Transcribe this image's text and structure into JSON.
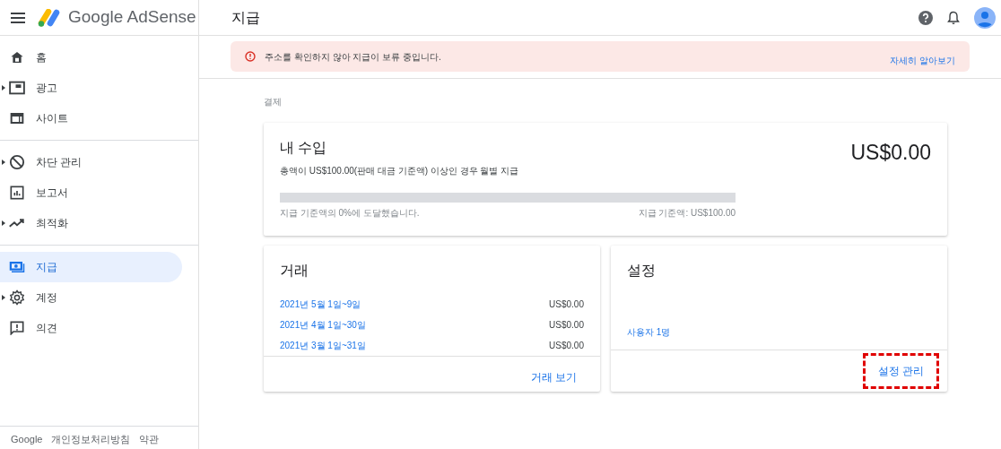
{
  "header": {
    "product": "Google AdSense",
    "page_title": "지급"
  },
  "sidebar": {
    "sections": [
      [
        {
          "label": "홈",
          "expandable": false,
          "selected": false
        },
        {
          "label": "광고",
          "expandable": true,
          "selected": false
        },
        {
          "label": "사이트",
          "expandable": false,
          "selected": false
        }
      ],
      [
        {
          "label": "차단 관리",
          "expandable": true,
          "selected": false
        },
        {
          "label": "보고서",
          "expandable": false,
          "selected": false
        },
        {
          "label": "최적화",
          "expandable": true,
          "selected": false
        }
      ],
      [
        {
          "label": "지급",
          "expandable": false,
          "selected": true
        },
        {
          "label": "계정",
          "expandable": true,
          "selected": false
        },
        {
          "label": "의견",
          "expandable": false,
          "selected": false
        }
      ]
    ],
    "footer": [
      "Google",
      "개인정보처리방침",
      "약관"
    ]
  },
  "alert": {
    "message": "주소를 확인하지 않아 지급이 보류 중입니다.",
    "link": "자세히 알아보기"
  },
  "breadcrumb": "결제",
  "earnings": {
    "title": "내 수입",
    "subtitle": "총액이 US$100.00(판매 대금 기준액) 이상인 경우 월별 지급",
    "amount": "US$0.00",
    "level": 0,
    "progress_text": "지급 기준액의 0%에 도달했습니다.",
    "threshold_text": "지급 기준액: US$100.00"
  },
  "transactions": {
    "title": "거래",
    "rows": [
      {
        "period": "2021년 5월 1일~9일",
        "amount": "US$0.00"
      },
      {
        "period": "2021년 4월 1일~30일",
        "amount": "US$0.00"
      },
      {
        "period": "2021년 3월 1일~31일",
        "amount": "US$0.00"
      }
    ],
    "action": {
      "label": "거래 보기",
      "highlighted": false
    }
  },
  "settings": {
    "title": "설정",
    "users_link": "사용자 1명",
    "action": {
      "label": "설정 관리",
      "highlighted": true
    }
  }
}
